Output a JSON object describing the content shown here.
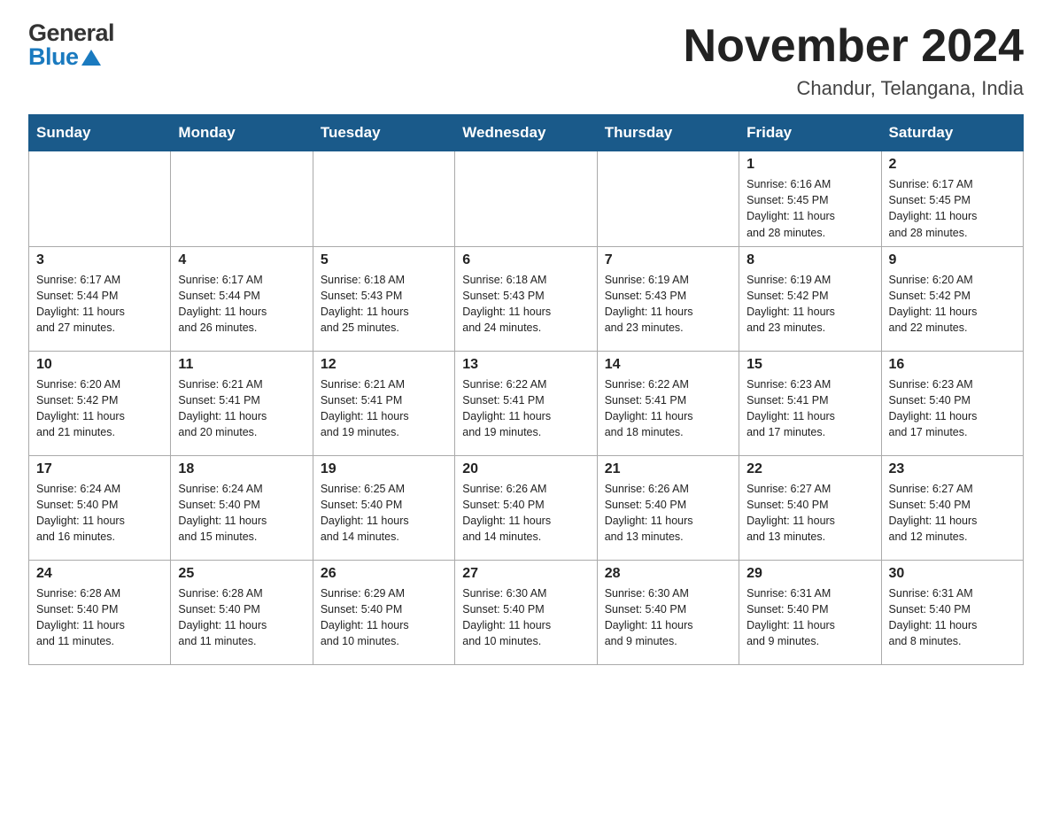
{
  "logo": {
    "general": "General",
    "blue": "Blue"
  },
  "title": "November 2024",
  "location": "Chandur, Telangana, India",
  "days_of_week": [
    "Sunday",
    "Monday",
    "Tuesday",
    "Wednesday",
    "Thursday",
    "Friday",
    "Saturday"
  ],
  "weeks": [
    [
      {
        "day": "",
        "info": ""
      },
      {
        "day": "",
        "info": ""
      },
      {
        "day": "",
        "info": ""
      },
      {
        "day": "",
        "info": ""
      },
      {
        "day": "",
        "info": ""
      },
      {
        "day": "1",
        "info": "Sunrise: 6:16 AM\nSunset: 5:45 PM\nDaylight: 11 hours\nand 28 minutes."
      },
      {
        "day": "2",
        "info": "Sunrise: 6:17 AM\nSunset: 5:45 PM\nDaylight: 11 hours\nand 28 minutes."
      }
    ],
    [
      {
        "day": "3",
        "info": "Sunrise: 6:17 AM\nSunset: 5:44 PM\nDaylight: 11 hours\nand 27 minutes."
      },
      {
        "day": "4",
        "info": "Sunrise: 6:17 AM\nSunset: 5:44 PM\nDaylight: 11 hours\nand 26 minutes."
      },
      {
        "day": "5",
        "info": "Sunrise: 6:18 AM\nSunset: 5:43 PM\nDaylight: 11 hours\nand 25 minutes."
      },
      {
        "day": "6",
        "info": "Sunrise: 6:18 AM\nSunset: 5:43 PM\nDaylight: 11 hours\nand 24 minutes."
      },
      {
        "day": "7",
        "info": "Sunrise: 6:19 AM\nSunset: 5:43 PM\nDaylight: 11 hours\nand 23 minutes."
      },
      {
        "day": "8",
        "info": "Sunrise: 6:19 AM\nSunset: 5:42 PM\nDaylight: 11 hours\nand 23 minutes."
      },
      {
        "day": "9",
        "info": "Sunrise: 6:20 AM\nSunset: 5:42 PM\nDaylight: 11 hours\nand 22 minutes."
      }
    ],
    [
      {
        "day": "10",
        "info": "Sunrise: 6:20 AM\nSunset: 5:42 PM\nDaylight: 11 hours\nand 21 minutes."
      },
      {
        "day": "11",
        "info": "Sunrise: 6:21 AM\nSunset: 5:41 PM\nDaylight: 11 hours\nand 20 minutes."
      },
      {
        "day": "12",
        "info": "Sunrise: 6:21 AM\nSunset: 5:41 PM\nDaylight: 11 hours\nand 19 minutes."
      },
      {
        "day": "13",
        "info": "Sunrise: 6:22 AM\nSunset: 5:41 PM\nDaylight: 11 hours\nand 19 minutes."
      },
      {
        "day": "14",
        "info": "Sunrise: 6:22 AM\nSunset: 5:41 PM\nDaylight: 11 hours\nand 18 minutes."
      },
      {
        "day": "15",
        "info": "Sunrise: 6:23 AM\nSunset: 5:41 PM\nDaylight: 11 hours\nand 17 minutes."
      },
      {
        "day": "16",
        "info": "Sunrise: 6:23 AM\nSunset: 5:40 PM\nDaylight: 11 hours\nand 17 minutes."
      }
    ],
    [
      {
        "day": "17",
        "info": "Sunrise: 6:24 AM\nSunset: 5:40 PM\nDaylight: 11 hours\nand 16 minutes."
      },
      {
        "day": "18",
        "info": "Sunrise: 6:24 AM\nSunset: 5:40 PM\nDaylight: 11 hours\nand 15 minutes."
      },
      {
        "day": "19",
        "info": "Sunrise: 6:25 AM\nSunset: 5:40 PM\nDaylight: 11 hours\nand 14 minutes."
      },
      {
        "day": "20",
        "info": "Sunrise: 6:26 AM\nSunset: 5:40 PM\nDaylight: 11 hours\nand 14 minutes."
      },
      {
        "day": "21",
        "info": "Sunrise: 6:26 AM\nSunset: 5:40 PM\nDaylight: 11 hours\nand 13 minutes."
      },
      {
        "day": "22",
        "info": "Sunrise: 6:27 AM\nSunset: 5:40 PM\nDaylight: 11 hours\nand 13 minutes."
      },
      {
        "day": "23",
        "info": "Sunrise: 6:27 AM\nSunset: 5:40 PM\nDaylight: 11 hours\nand 12 minutes."
      }
    ],
    [
      {
        "day": "24",
        "info": "Sunrise: 6:28 AM\nSunset: 5:40 PM\nDaylight: 11 hours\nand 11 minutes."
      },
      {
        "day": "25",
        "info": "Sunrise: 6:28 AM\nSunset: 5:40 PM\nDaylight: 11 hours\nand 11 minutes."
      },
      {
        "day": "26",
        "info": "Sunrise: 6:29 AM\nSunset: 5:40 PM\nDaylight: 11 hours\nand 10 minutes."
      },
      {
        "day": "27",
        "info": "Sunrise: 6:30 AM\nSunset: 5:40 PM\nDaylight: 11 hours\nand 10 minutes."
      },
      {
        "day": "28",
        "info": "Sunrise: 6:30 AM\nSunset: 5:40 PM\nDaylight: 11 hours\nand 9 minutes."
      },
      {
        "day": "29",
        "info": "Sunrise: 6:31 AM\nSunset: 5:40 PM\nDaylight: 11 hours\nand 9 minutes."
      },
      {
        "day": "30",
        "info": "Sunrise: 6:31 AM\nSunset: 5:40 PM\nDaylight: 11 hours\nand 8 minutes."
      }
    ]
  ]
}
